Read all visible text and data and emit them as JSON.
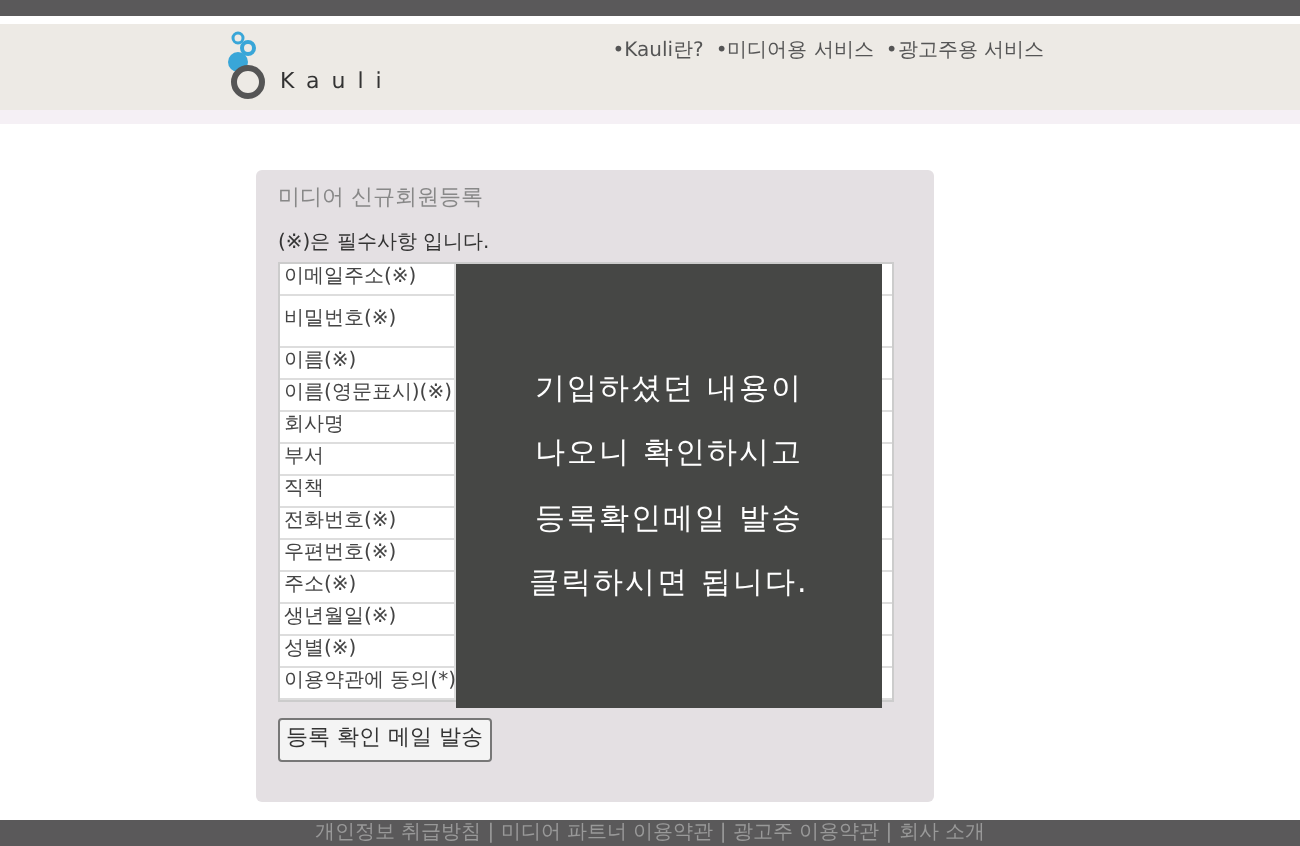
{
  "header": {
    "logo_text": "Kauli",
    "nav": [
      "•Kauli란?",
      "•미디어용 서비스",
      "•광고주용 서비스"
    ]
  },
  "form": {
    "title": "미디어 신규회원등록",
    "note": "(※)은  필수사항  입니다.",
    "fields": [
      {
        "label": "이메일주소(※)",
        "kind": "single"
      },
      {
        "label": "비밀번호(※)",
        "kind": "double"
      },
      {
        "label": "이름(※)",
        "kind": "single"
      },
      {
        "label": "이름(영문표시)(※)",
        "kind": "single"
      },
      {
        "label": "회사명",
        "kind": "single"
      },
      {
        "label": "부서",
        "kind": "single"
      },
      {
        "label": "직책",
        "kind": "single"
      },
      {
        "label": "전화번호(※)",
        "kind": "single"
      },
      {
        "label": "우편번호(※)",
        "kind": "single"
      },
      {
        "label": "주소(※)",
        "kind": "single"
      },
      {
        "label": "생년월일(※)",
        "kind": "single"
      },
      {
        "label": "성별(※)",
        "kind": "single"
      },
      {
        "label": "이용약관에 동의(*)",
        "kind": "single"
      }
    ],
    "submit": "등록 확인 메일 발송"
  },
  "overlay": {
    "lines": [
      "기입하셨던 내용이",
      "나오니 확인하시고",
      "등록확인메일 발송",
      "클릭하시면 됩니다."
    ]
  },
  "footer": {
    "links": [
      "개인정보 취급방침 | 미디어 파트너 이용약관 | 광고주 이용약관 | 회사 소개"
    ]
  }
}
